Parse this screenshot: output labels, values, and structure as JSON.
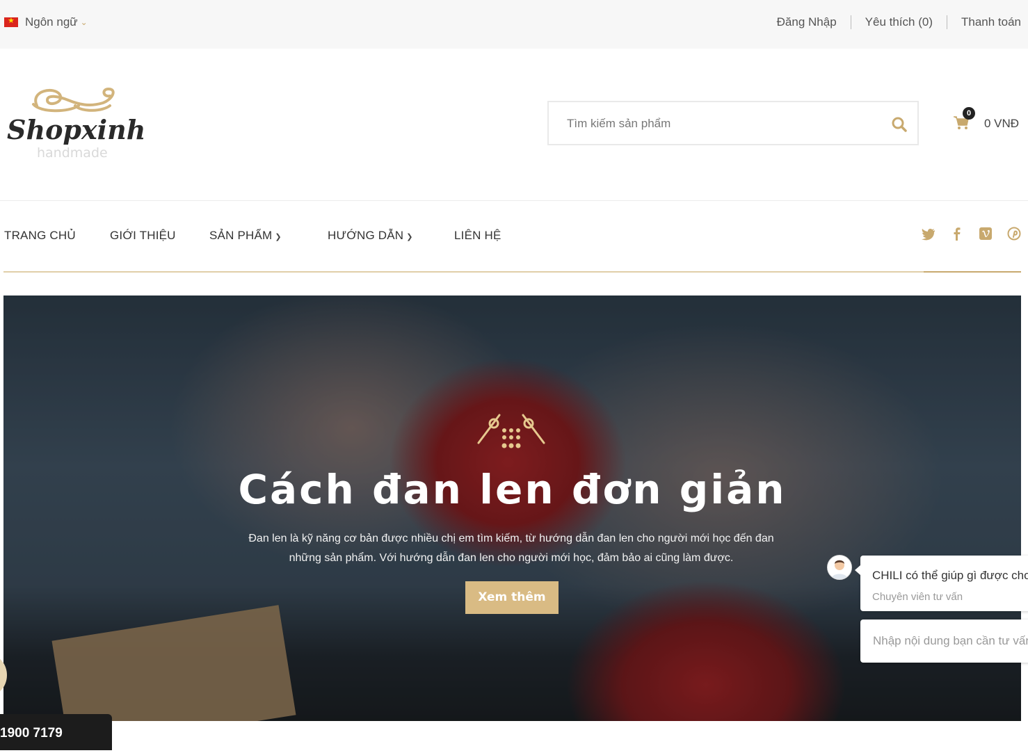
{
  "topbar": {
    "language_label": "Ngôn ngữ",
    "links": {
      "login": "Đăng Nhập",
      "wishlist": "Yêu thích (0)",
      "checkout": "Thanh toán"
    }
  },
  "logo": {
    "name": "Shopxinh",
    "tagline": "handmade"
  },
  "search": {
    "placeholder": "Tìm kiếm sản phẩm"
  },
  "cart": {
    "count": "0",
    "total": "0 VNĐ"
  },
  "nav": {
    "home": "TRANG CHỦ",
    "about": "GIỚI THIỆU",
    "products": "SẢN PHẨM",
    "guides": "HƯỚNG DẪN",
    "contact": "LIÊN HỆ",
    "social_icons": [
      "twitter-icon",
      "facebook-icon",
      "vimeo-icon",
      "pinterest-icon"
    ]
  },
  "hero": {
    "title": "Cách đan len đơn giản",
    "description": "Đan len là kỹ năng cơ bản được nhiều chị em tìm kiếm, từ hướng dẫn đan len cho người mới học đến đan những sản phẩm. Với hướng dẫn đan len cho người mới học, đảm bảo ai cũng làm được.",
    "button": "Xem thêm"
  },
  "chat": {
    "message": "CHILI có thể giúp gì được cho",
    "role": "Chuyên viên tư vấn",
    "input_placeholder": "Nhập nội dung bạn cần tư vấn"
  },
  "hotline": {
    "number": "1900 7179"
  },
  "colors": {
    "accent": "#c8a96e",
    "button": "#d9bb84",
    "topbar_bg": "#f7f7f7"
  }
}
